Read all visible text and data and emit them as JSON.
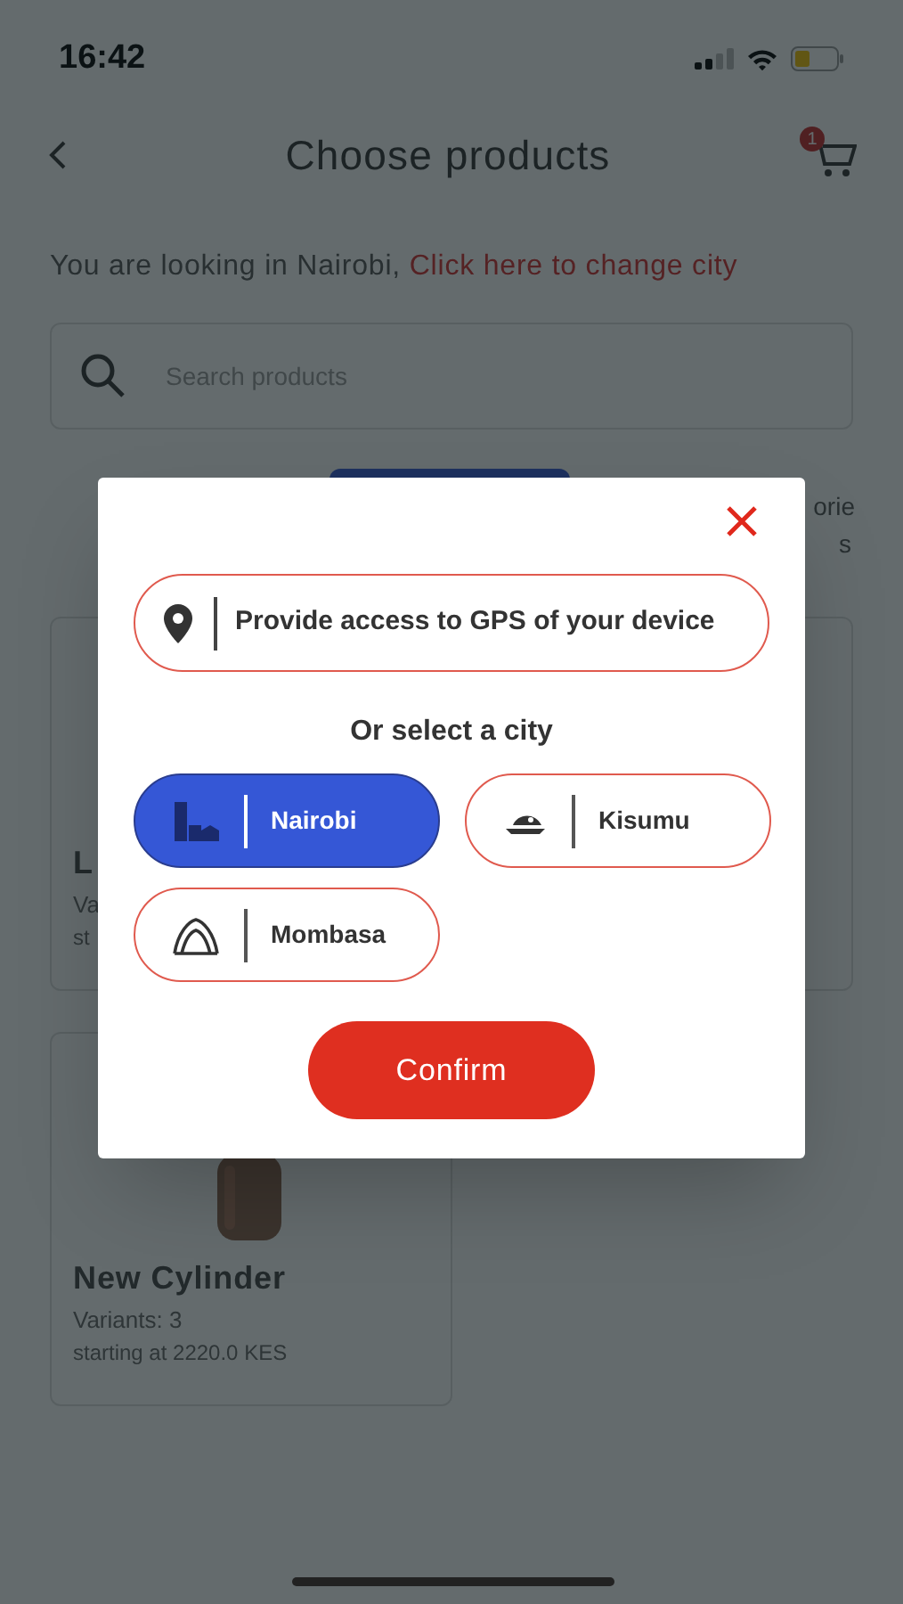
{
  "status_bar": {
    "time": "16:42"
  },
  "header": {
    "title": "Choose products",
    "cart_count": "1"
  },
  "location_notice": {
    "text": "You are looking in Nairobi, ",
    "link": "Click here to change city"
  },
  "search": {
    "placeholder": "Search products"
  },
  "tab_strip": {
    "right_label_line_1": "orie",
    "right_label_line_2": "s"
  },
  "products": [
    {
      "title": "L",
      "variants": "Va",
      "price": "st"
    },
    {
      "title": "New Cylinder",
      "variants": "Variants: 3",
      "price": "starting at 2220.0 KES",
      "kind": "picture"
    }
  ],
  "city_dialog": {
    "gps_button": "Provide access to GPS of your device",
    "subtitle": "Or select a city",
    "cities": [
      {
        "name": "Nairobi",
        "selected": true,
        "kind": "towers"
      },
      {
        "name": "Kisumu",
        "selected": false,
        "kind": "fish"
      },
      {
        "name": "Mombasa",
        "selected": false,
        "kind": "tusks"
      }
    ],
    "confirm": "Confirm"
  }
}
